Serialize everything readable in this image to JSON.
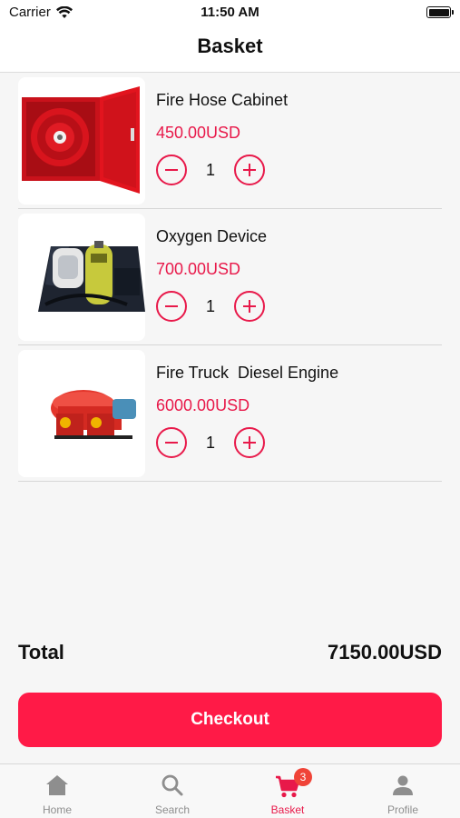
{
  "status_bar": {
    "carrier": "Carrier",
    "time": "11:50 AM",
    "battery_level": 0.95
  },
  "header": {
    "title": "Basket"
  },
  "items": [
    {
      "name": "Fire Hose Cabinet",
      "price": "450.00USD",
      "quantity": "1",
      "image": "fire-hose-cabinet"
    },
    {
      "name": "Oxygen Device",
      "price": "700.00USD",
      "quantity": "1",
      "image": "oxygen-device"
    },
    {
      "name": "Fire Truck  Diesel Engine",
      "price": "6000.00USD",
      "quantity": "1",
      "image": "fire-truck-diesel-engine"
    }
  ],
  "summary": {
    "total_label": "Total",
    "total_value": "7150.00USD"
  },
  "checkout": {
    "label": "Checkout"
  },
  "tabs": [
    {
      "label": "Home",
      "icon": "home-icon",
      "active": false
    },
    {
      "label": "Search",
      "icon": "search-icon",
      "active": false
    },
    {
      "label": "Basket",
      "icon": "cart-icon",
      "active": true,
      "badge": "3"
    },
    {
      "label": "Profile",
      "icon": "person-icon",
      "active": false
    }
  ],
  "colors": {
    "accent": "#e8194a",
    "button": "#ff1a47",
    "badge": "#f04438",
    "inactive_tab": "#8e8e8e"
  }
}
